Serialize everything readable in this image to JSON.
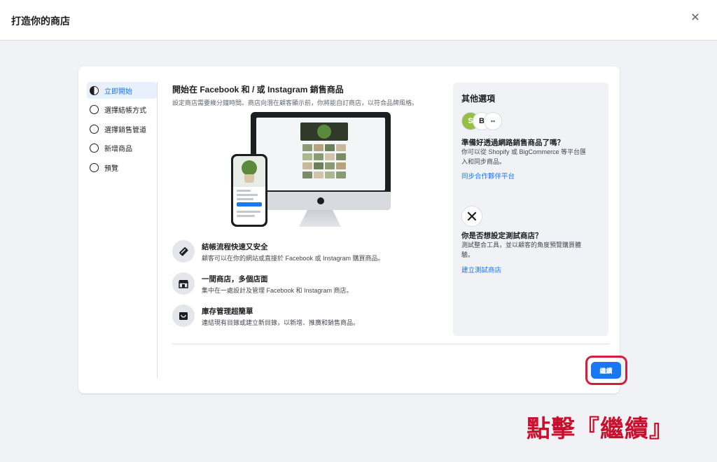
{
  "header": {
    "title": "打造你的商店",
    "close_icon": "close-icon"
  },
  "steps": [
    {
      "label": "立即開始",
      "active": true
    },
    {
      "label": "選擇結帳方式",
      "active": false
    },
    {
      "label": "選擇銷售管道",
      "active": false
    },
    {
      "label": "新增商品",
      "active": false
    },
    {
      "label": "預覽",
      "active": false
    }
  ],
  "main": {
    "title": "開始在 Facebook 和 / 或 Instagram 銷售商品",
    "subtitle": "設定商店需要幾分鐘時間。商店向潛在顧客顯示前，你將能自訂商店，以符合品牌風格。",
    "features": [
      {
        "icon": "credit-card-icon",
        "title": "結帳流程快速又安全",
        "desc": "顧客可以在你的網站或直接於 Facebook 或 Instagram 購買商品。"
      },
      {
        "icon": "storefront-icon",
        "title": "一間商店，多個店面",
        "desc": "集中在一處設計及管理 Facebook 和 Instagram 商店。"
      },
      {
        "icon": "inventory-icon",
        "title": "庫存管理超簡單",
        "desc": "連結現有目錄或建立新目錄，以新增、推廣和銷售商品。"
      }
    ]
  },
  "side": {
    "title": "其他選項",
    "partner": {
      "title": "準備好透過網路銷售商品了嗎？",
      "desc": "你可以從 Shopify 或 BigCommerce 等平台匯入和同步商品。",
      "link": "同步合作夥伴平台",
      "logos": [
        "shopify-icon",
        "bigcommerce-icon",
        "more-partners-icon"
      ]
    },
    "test": {
      "title": "你是否想設定測試商店？",
      "desc": "測試整合工具，並以顧客的角度預覽購買體驗。",
      "link": "建立測試商店",
      "icon": "tools-icon"
    }
  },
  "footer": {
    "continue_label": "繼續"
  },
  "annotation": {
    "text": "點擊『繼續』",
    "color": "#c8102e"
  },
  "colors": {
    "accent": "#1877f2",
    "highlight": "#d11f3f"
  }
}
